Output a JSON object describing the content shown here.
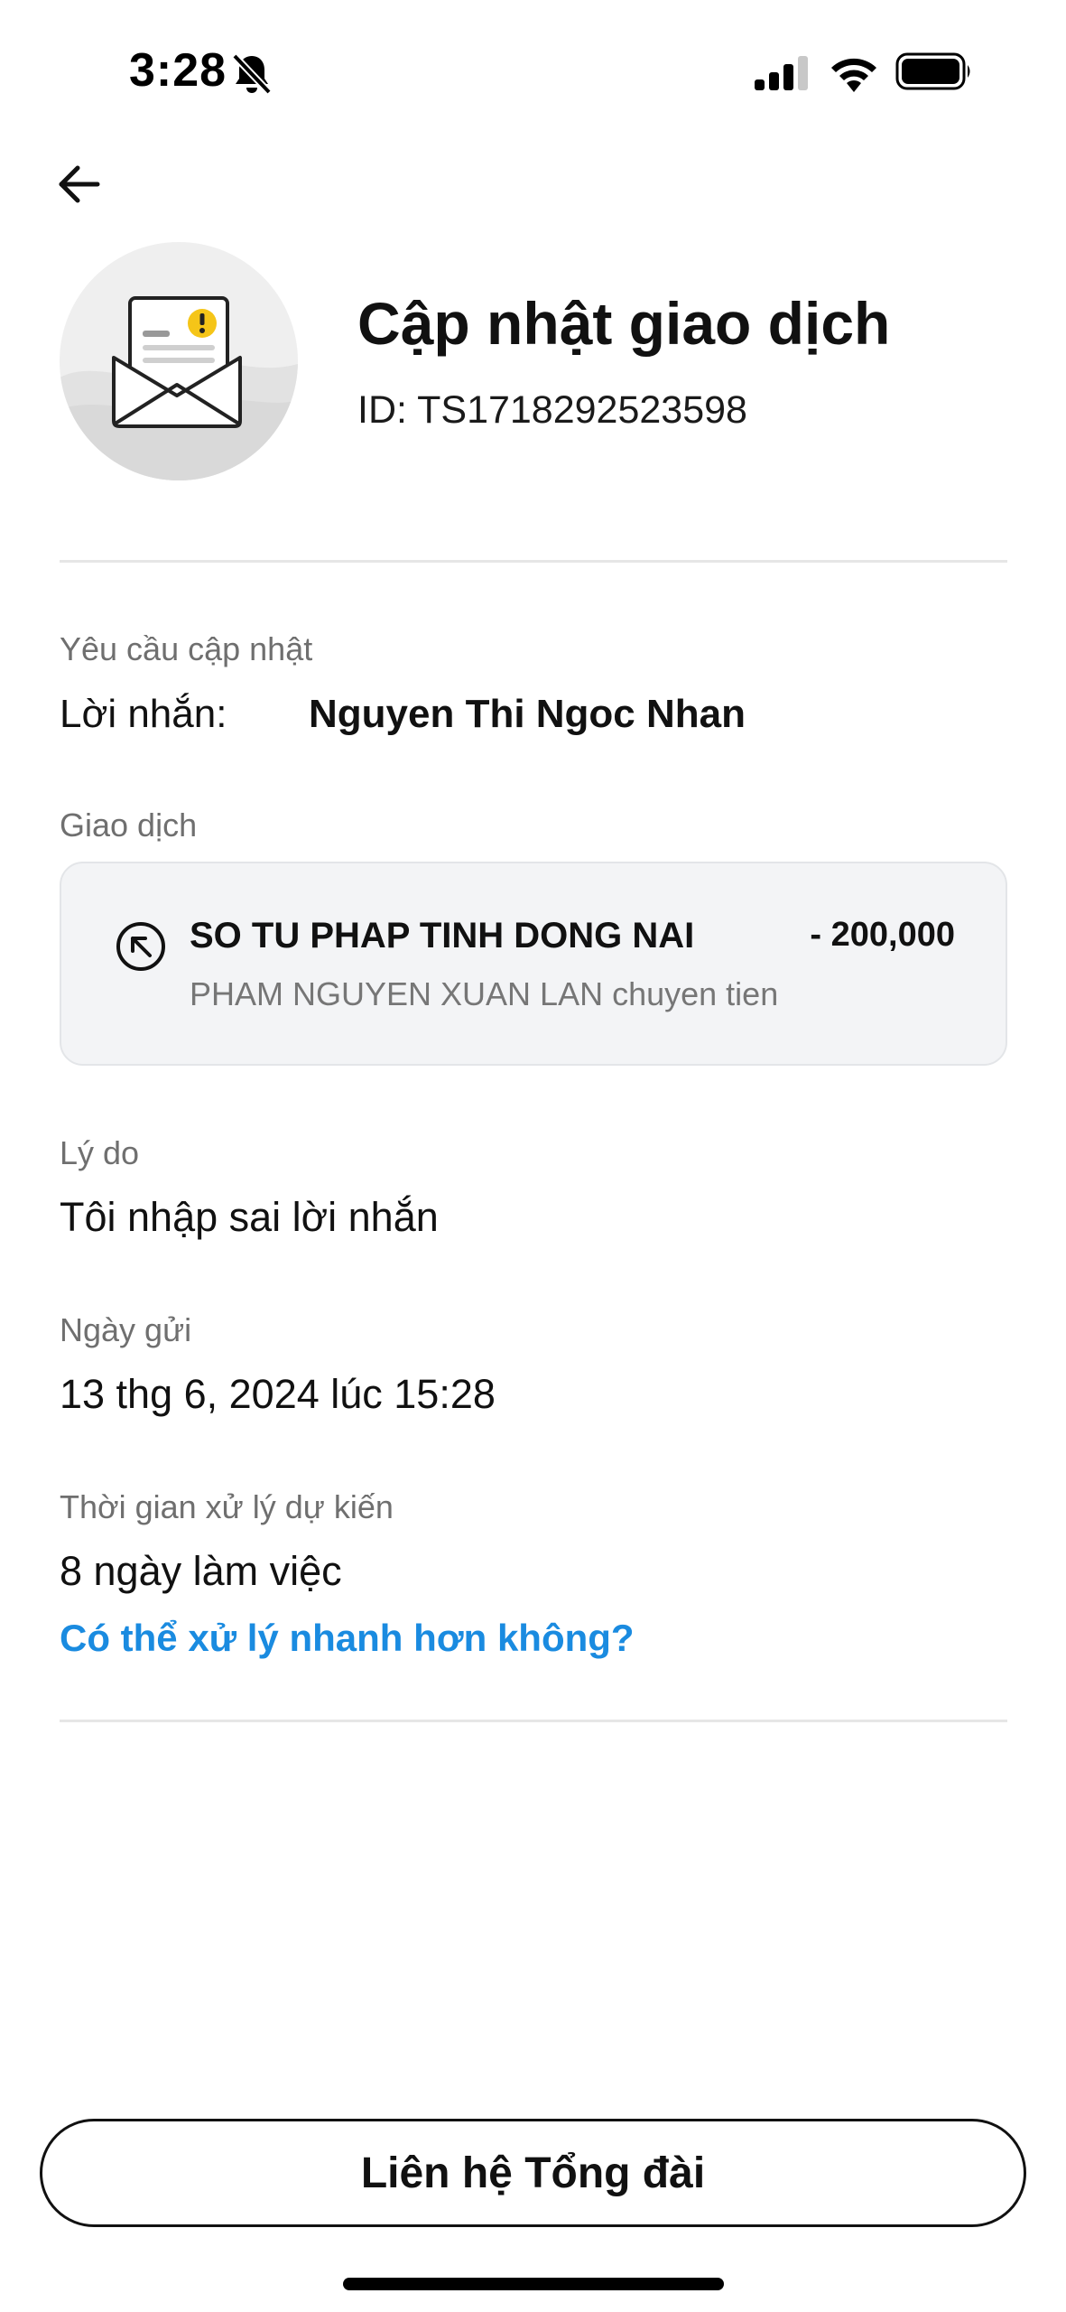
{
  "status_bar": {
    "time": "3:28",
    "icons": [
      "bell-slash-icon",
      "signal-icon",
      "wifi-icon",
      "battery-icon"
    ]
  },
  "header": {
    "back_icon": "arrow-left-icon",
    "hero_icon": "envelope-alert-icon",
    "title": "Cập nhật giao dịch",
    "request_id": "ID: TS1718292523598"
  },
  "update_request": {
    "section_label": "Yêu cầu cập nhật",
    "message_label": "Lời nhắn:",
    "message_value": "Nguyen Thi Ngoc Nhan"
  },
  "transaction": {
    "section_label": "Giao dịch",
    "icon": "outgoing-arrow-icon",
    "name": "SO TU PHAP TINH DONG NAI",
    "amount": "- 200,000",
    "description": "PHAM NGUYEN XUAN LAN chuyen tien"
  },
  "reason": {
    "label": "Lý do",
    "value": "Tôi nhập sai lời nhắn"
  },
  "sent_date": {
    "label": "Ngày gửi",
    "value": "13 thg 6, 2024 lúc 15:28"
  },
  "processing_time": {
    "label": "Thời gian xử lý dự kiến",
    "value": "8 ngày làm việc",
    "faster_link": "Có thể xử lý nhanh hơn không?"
  },
  "footer": {
    "contact_button": "Liên hệ Tổng đài"
  },
  "colors": {
    "link": "#1a8be0",
    "card_background": "#f3f4f6",
    "warning_badge": "#f5c518"
  }
}
